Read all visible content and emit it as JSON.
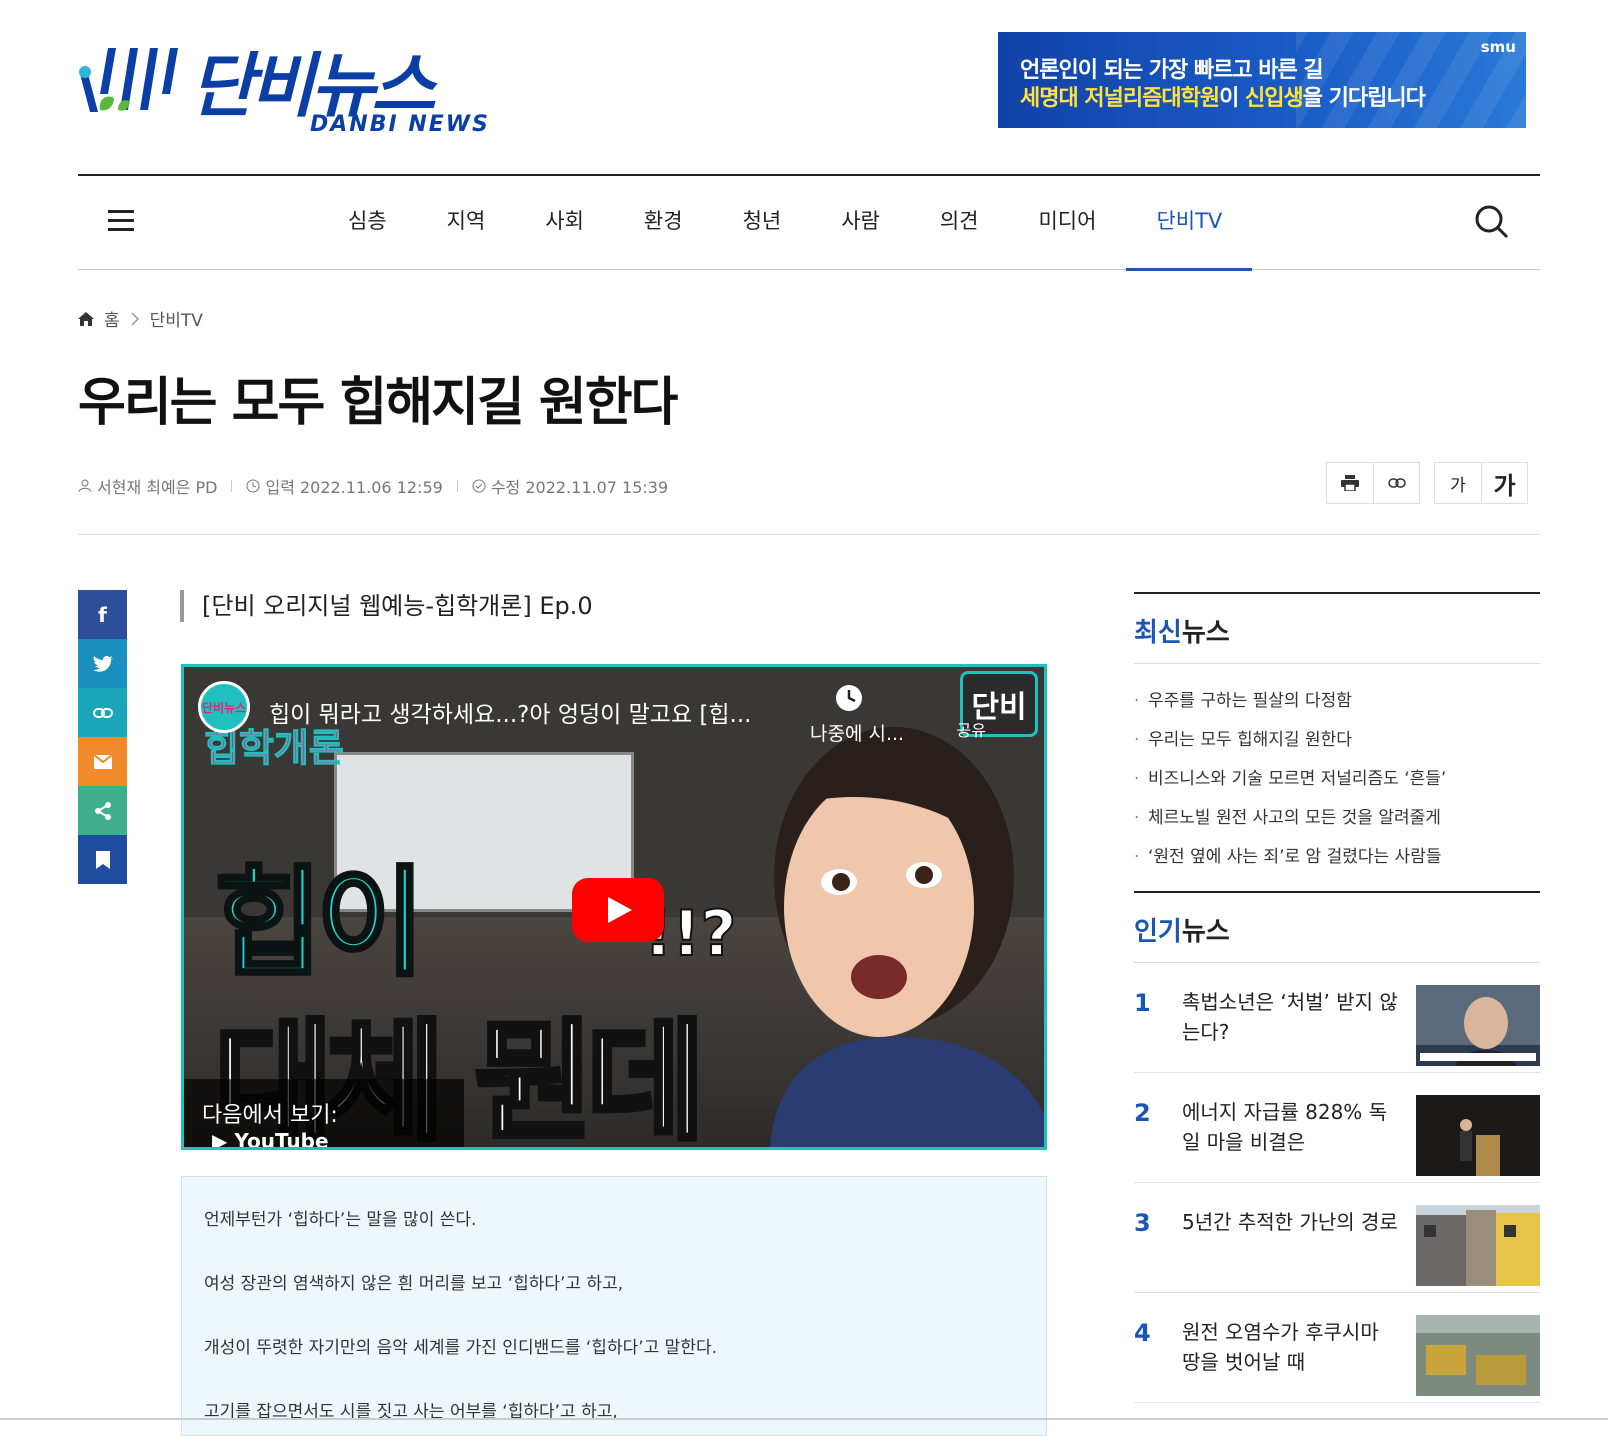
{
  "header": {
    "logo_ko": "단비뉴스",
    "logo_en": "DANBI NEWS",
    "banner": {
      "line1": "언론인이 되는 가장 빠르고 바른 길",
      "line2_a": "세명대 저널리즘대학원",
      "line2_b": "이 ",
      "line2_c": "신입생",
      "line2_d": "을 기다립니다",
      "brand": "smu"
    }
  },
  "nav": {
    "items": [
      "심층",
      "지역",
      "사회",
      "환경",
      "청년",
      "사람",
      "의견",
      "미디어",
      "단비TV"
    ],
    "active": "단비TV"
  },
  "breadcrumb": {
    "home": "홈",
    "section": "단비TV"
  },
  "article": {
    "title": "우리는 모두 힙해지길 원한다",
    "author": "서현재 최예은 PD",
    "published": "입력 2022.11.06 12:59",
    "modified": "수정 2022.11.07 15:39",
    "font_small": "가",
    "font_large": "가",
    "subtitle": "[단비 오리지널 웹예능-힙학개론] Ep.0",
    "video": {
      "title": "힙이 뭐라고 생각하세요...?아 엉덩이 말고요 [힙...",
      "watch_later": "나중에 시...",
      "share": "공유",
      "watch_on": "다음에서 보기:",
      "youtube": "YouTube",
      "channel": "단비뉴스",
      "thumb_overlay": "힙학개론",
      "thumb_line1": "힙이",
      "thumb_line2": "대체 뭔데",
      "thumb_q": "!!?",
      "corner_logo": "단비"
    },
    "paragraphs": [
      "언제부턴가 ‘힙하다’는 말을 많이 쓴다.",
      "여성 장관의 염색하지 않은 흰 머리를 보고 ‘힙하다’고 하고,",
      "개성이 뚜렷한 자기만의 음악 세계를 가진 인디밴드를 ‘힙하다’고 말한다.",
      "고기를 잡으면서도 시를 짓고 사는 어부를 ‘힙하다’고 하고,"
    ]
  },
  "sidebar": {
    "latest_title_a": "최신",
    "latest_title_b": "뉴스",
    "latest": [
      "우주를 구하는 필살의 다정함",
      "우리는 모두 힙해지길 원한다",
      "비즈니스와 기술 모르면 저널리즘도 ‘흔들’",
      "체르노빌 원전 사고의 모든 것을 알려줄게",
      "‘원전 옆에 사는 죄’로 암 걸렸다는 사람들"
    ],
    "popular_title_a": "인기",
    "popular_title_b": "뉴스",
    "popular": [
      {
        "rank": "1",
        "title": "촉법소년은 ‘처벌’ 받지 않는다?"
      },
      {
        "rank": "2",
        "title": "에너지 자급률 828% 독일 마을 비결은"
      },
      {
        "rank": "3",
        "title": "5년간 추적한 가난의 경로"
      },
      {
        "rank": "4",
        "title": "원전 오염수가 후쿠시마 땅을 벗어날 때"
      }
    ]
  },
  "colors": {
    "brand": "#0b3fa5",
    "accent": "#1a56b6",
    "facebook": "#2d4f9a",
    "twitter": "#1a8fc0",
    "link": "#1aa6b8",
    "mail": "#f08a2a",
    "share": "#3fae8a",
    "bookmark": "#1e4da0"
  }
}
